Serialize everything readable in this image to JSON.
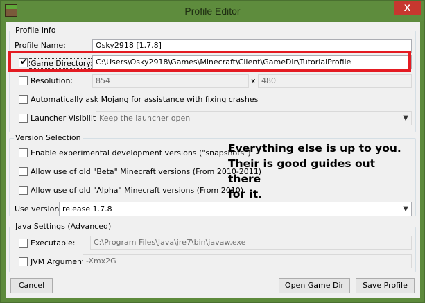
{
  "window": {
    "title": "Profile Editor",
    "close_label": "X",
    "app_icon": "minecraft-grass-block-icon",
    "frame_color": "#5d8a3c",
    "close_color": "#c7372f"
  },
  "profile_info": {
    "legend": "Profile Info",
    "profile_name_label": "Profile Name:",
    "profile_name_value": "Osky2918 [1.7.8]",
    "game_dir_label": "Game Directory:",
    "game_dir_checked": true,
    "game_dir_value": "C:\\Users\\Osky2918\\Games\\Minecraft\\Client\\GameDir\\TutorialProfile",
    "resolution_label": "Resolution:",
    "resolution_checked": false,
    "resolution_width": "854",
    "resolution_x": "x",
    "resolution_height": "480",
    "auto_mojang_label": "Automatically ask Mojang for assistance with fixing crashes",
    "auto_mojang_checked": false,
    "launcher_visibility_label": "Launcher Visibility:",
    "launcher_visibility_checked": false,
    "launcher_visibility_value": "Keep the launcher open"
  },
  "version_selection": {
    "legend": "Version Selection",
    "snapshots_label": "Enable experimental development versions (\"snapshots\")",
    "beta_label": "Allow use of old \"Beta\" Minecraft versions (From 2010-2011)",
    "alpha_label": "Allow use of old \"Alpha\" Minecraft versions (From 2010)",
    "use_version_label": "Use version:",
    "use_version_value": "release 1.7.8"
  },
  "java_settings": {
    "legend": "Java Settings (Advanced)",
    "executable_label": "Executable:",
    "executable_value": "C:\\Program Files\\Java\\jre7\\bin\\javaw.exe",
    "jvm_label": "JVM Arguments:",
    "jvm_value": "-Xmx2G"
  },
  "buttons": {
    "cancel": "Cancel",
    "open_game_dir": "Open Game Dir",
    "save_profile": "Save Profile"
  },
  "annotation": {
    "line1": "Everything else is up to you.",
    "line2": "Their is good guides out there",
    "line3": "for it.",
    "highlight_color": "#e41b22"
  }
}
